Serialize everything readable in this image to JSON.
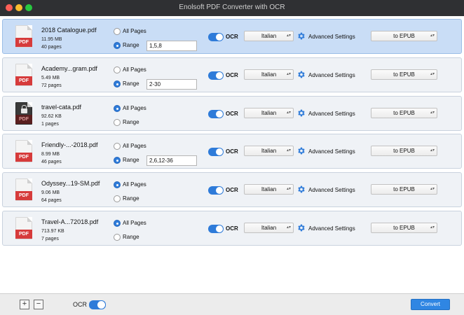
{
  "window": {
    "title": "Enolsoft PDF Converter with OCR"
  },
  "labels": {
    "all_pages": "All Pages",
    "range": "Range",
    "ocr": "OCR",
    "advanced": "Advanced Settings",
    "pdf_badge": "PDF"
  },
  "files": [
    {
      "name": "2018 Catalogue.pdf",
      "size": "11.95 MB",
      "pages": "40 pages",
      "mode": "range",
      "range": "1,5,8",
      "language": "Italian",
      "format": "to EPUB",
      "locked": false,
      "selected": true
    },
    {
      "name": "Academy...gram.pdf",
      "size": "5.49 MB",
      "pages": "72 pages",
      "mode": "range",
      "range": "2-30",
      "language": "Italian",
      "format": "to EPUB",
      "locked": false,
      "selected": false
    },
    {
      "name": "travel-cata.pdf",
      "size": "92.62 KB",
      "pages": "1 pages",
      "mode": "all",
      "range": "",
      "language": "Italian",
      "format": "to EPUB",
      "locked": true,
      "selected": false
    },
    {
      "name": "Friendly-...-2018.pdf",
      "size": "8.99 MB",
      "pages": "46 pages",
      "mode": "range",
      "range": "2,6,12-36",
      "language": "Italian",
      "format": "to EPUB",
      "locked": false,
      "selected": false
    },
    {
      "name": "Odyssey...19-SM.pdf",
      "size": "9.06 MB",
      "pages": "64 pages",
      "mode": "all",
      "range": "",
      "language": "Italian",
      "format": "to EPUB",
      "locked": false,
      "selected": false
    },
    {
      "name": "Travel-A...72018.pdf",
      "size": "713.97 KB",
      "pages": "7 pages",
      "mode": "all",
      "range": "",
      "language": "Italian",
      "format": "to EPUB",
      "locked": false,
      "selected": false
    }
  ],
  "footer": {
    "add_label": "+",
    "remove_label": "−",
    "ocr_label": "OCR",
    "convert_label": "Convert"
  },
  "colors": {
    "accent": "#2f86e3",
    "selected_row": "#c9ddf6",
    "row": "#eff2f6",
    "pdf_red": "#d63b3b"
  }
}
